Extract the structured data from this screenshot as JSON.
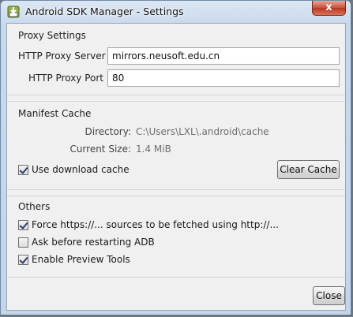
{
  "window": {
    "title": "Android SDK Manager - Settings",
    "close_glyph": "x"
  },
  "proxy": {
    "group_title": "Proxy Settings",
    "server_label": "HTTP Proxy Server",
    "server_value": "mirrors.neusoft.edu.cn",
    "port_label": "HTTP Proxy Port",
    "port_value": "80"
  },
  "manifest": {
    "group_title": "Manifest Cache",
    "directory_label": "Directory:",
    "directory_value": "C:\\Users\\LXL\\.android\\cache",
    "size_label": "Current Size:",
    "size_value": "1.4 MiB",
    "use_cache_label": "Use download cache",
    "use_cache_checked": true,
    "clear_button": "Clear Cache"
  },
  "others": {
    "group_title": "Others",
    "options": [
      {
        "label": "Force https://... sources to be fetched using http://...",
        "checked": true
      },
      {
        "label": "Ask before restarting ADB",
        "checked": false
      },
      {
        "label": "Enable Preview Tools",
        "checked": true
      }
    ]
  },
  "footer": {
    "close_button": "Close"
  },
  "icons": {
    "app": "android-sdk-download-icon",
    "close": "close-icon"
  }
}
